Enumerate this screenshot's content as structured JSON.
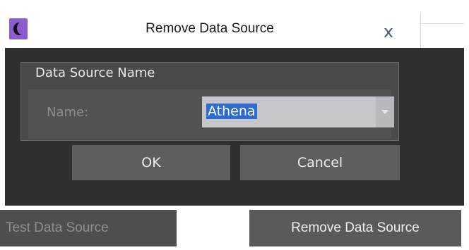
{
  "dialog": {
    "title": "Remove Data Source",
    "close_glyph": "x",
    "icon": "moon-logo-icon",
    "group_label": "Data Source Name",
    "name_label": "Name:",
    "selected_value": "Athena",
    "ok_label": "OK",
    "cancel_label": "Cancel"
  },
  "footer": {
    "test_label": "Test Data Source",
    "remove_label": "Remove Data Source"
  },
  "colors": {
    "dialog_bg": "#2f2f2f",
    "accent_icon": "#8a5cd0",
    "selection": "#2f6ad0"
  }
}
